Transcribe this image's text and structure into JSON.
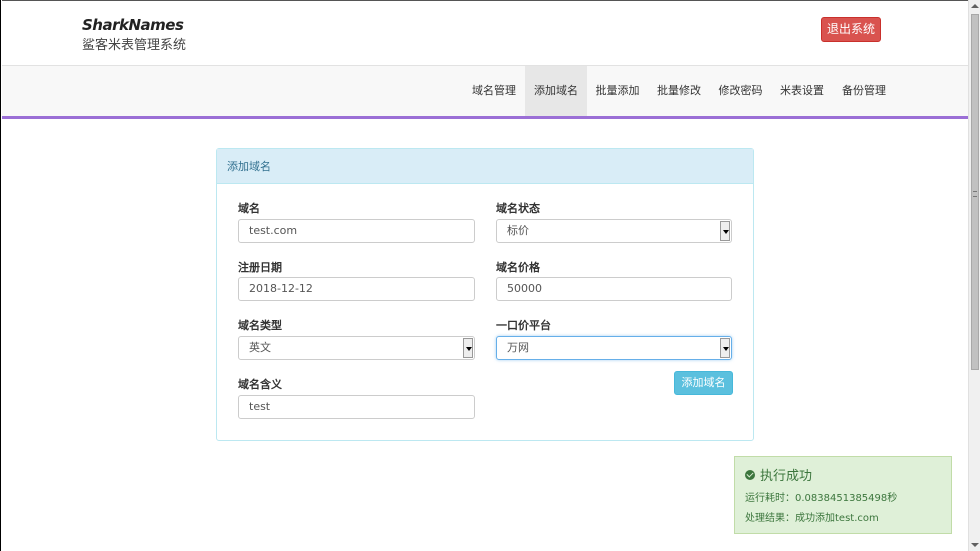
{
  "header": {
    "logo": "SharkNames",
    "subtitle": "鲨客米表管理系统",
    "logout_label": "退出系统"
  },
  "nav": {
    "items": [
      {
        "label": "域名管理"
      },
      {
        "label": "添加域名",
        "active": true
      },
      {
        "label": "批量添加"
      },
      {
        "label": "批量修改"
      },
      {
        "label": "修改密码"
      },
      {
        "label": "米表设置"
      },
      {
        "label": "备份管理"
      }
    ]
  },
  "panel": {
    "title": "添加域名",
    "fields": {
      "domain": {
        "label": "域名",
        "value": "test.com"
      },
      "status": {
        "label": "域名状态",
        "value": "标价"
      },
      "reg_date": {
        "label": "注册日期",
        "value": "2018-12-12"
      },
      "price": {
        "label": "域名价格",
        "value": "50000"
      },
      "type": {
        "label": "域名类型",
        "value": "英文"
      },
      "platform": {
        "label": "一口价平台",
        "value": "万网"
      },
      "meaning": {
        "label": "域名含义",
        "value": "test"
      }
    },
    "submit_label": "添加域名"
  },
  "toast": {
    "title": "执行成功",
    "runtime": "运行耗时：0.0838451385498秒",
    "result": "处理结果：成功添加test.com"
  },
  "colors": {
    "nav_accent": "#9b6fd6",
    "logout": "#d9534f",
    "submit": "#5bc0de",
    "panel_heading": "#d9edf7",
    "toast_bg": "#dff0d8"
  }
}
